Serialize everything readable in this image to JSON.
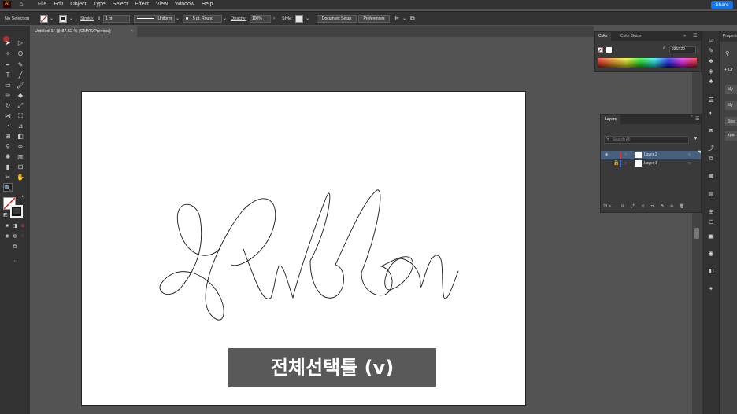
{
  "app": {
    "logo": "Ai",
    "menus": [
      "File",
      "Edit",
      "Object",
      "Type",
      "Select",
      "Effect",
      "View",
      "Window",
      "Help"
    ],
    "share_label": "Share"
  },
  "control_bar": {
    "selection_status": "No Selection",
    "stroke_label": "Stroke:",
    "stroke_weight": "1 pt",
    "profile_label": "Uniform",
    "brush_label": "5 pt. Round",
    "opacity_label": "Opacity:",
    "opacity_value": "100%",
    "style_label": "Style:",
    "document_setup_label": "Document Setup",
    "preferences_label": "Preferences"
  },
  "document_tab": {
    "title": "Untitled-1* @ 87.52 % (CMYK/Preview)",
    "close_glyph": "×"
  },
  "canvas": {
    "caption": "전체선택툴 (v)"
  },
  "color_panel": {
    "tabs": [
      "Color",
      "Color Guide"
    ],
    "hex_value": "231F20"
  },
  "layers_panel": {
    "tab": "Layers",
    "search_placeholder": "Search All",
    "layers": [
      {
        "name": "Layer 2",
        "color": "#d23838",
        "selected": true,
        "visible": true,
        "locked": false
      },
      {
        "name": "Layer 1",
        "color": "#4a6fd8",
        "selected": false,
        "visible": false,
        "locked": true
      }
    ],
    "footer_count": "2 La..."
  },
  "properties_panel": {
    "title": "Properties",
    "items": [
      "+ Cr",
      "My",
      "My",
      "Stoc",
      "자주"
    ]
  },
  "colors": {
    "accent": "#1473e6",
    "selected_layer_bg": "#46607e"
  }
}
